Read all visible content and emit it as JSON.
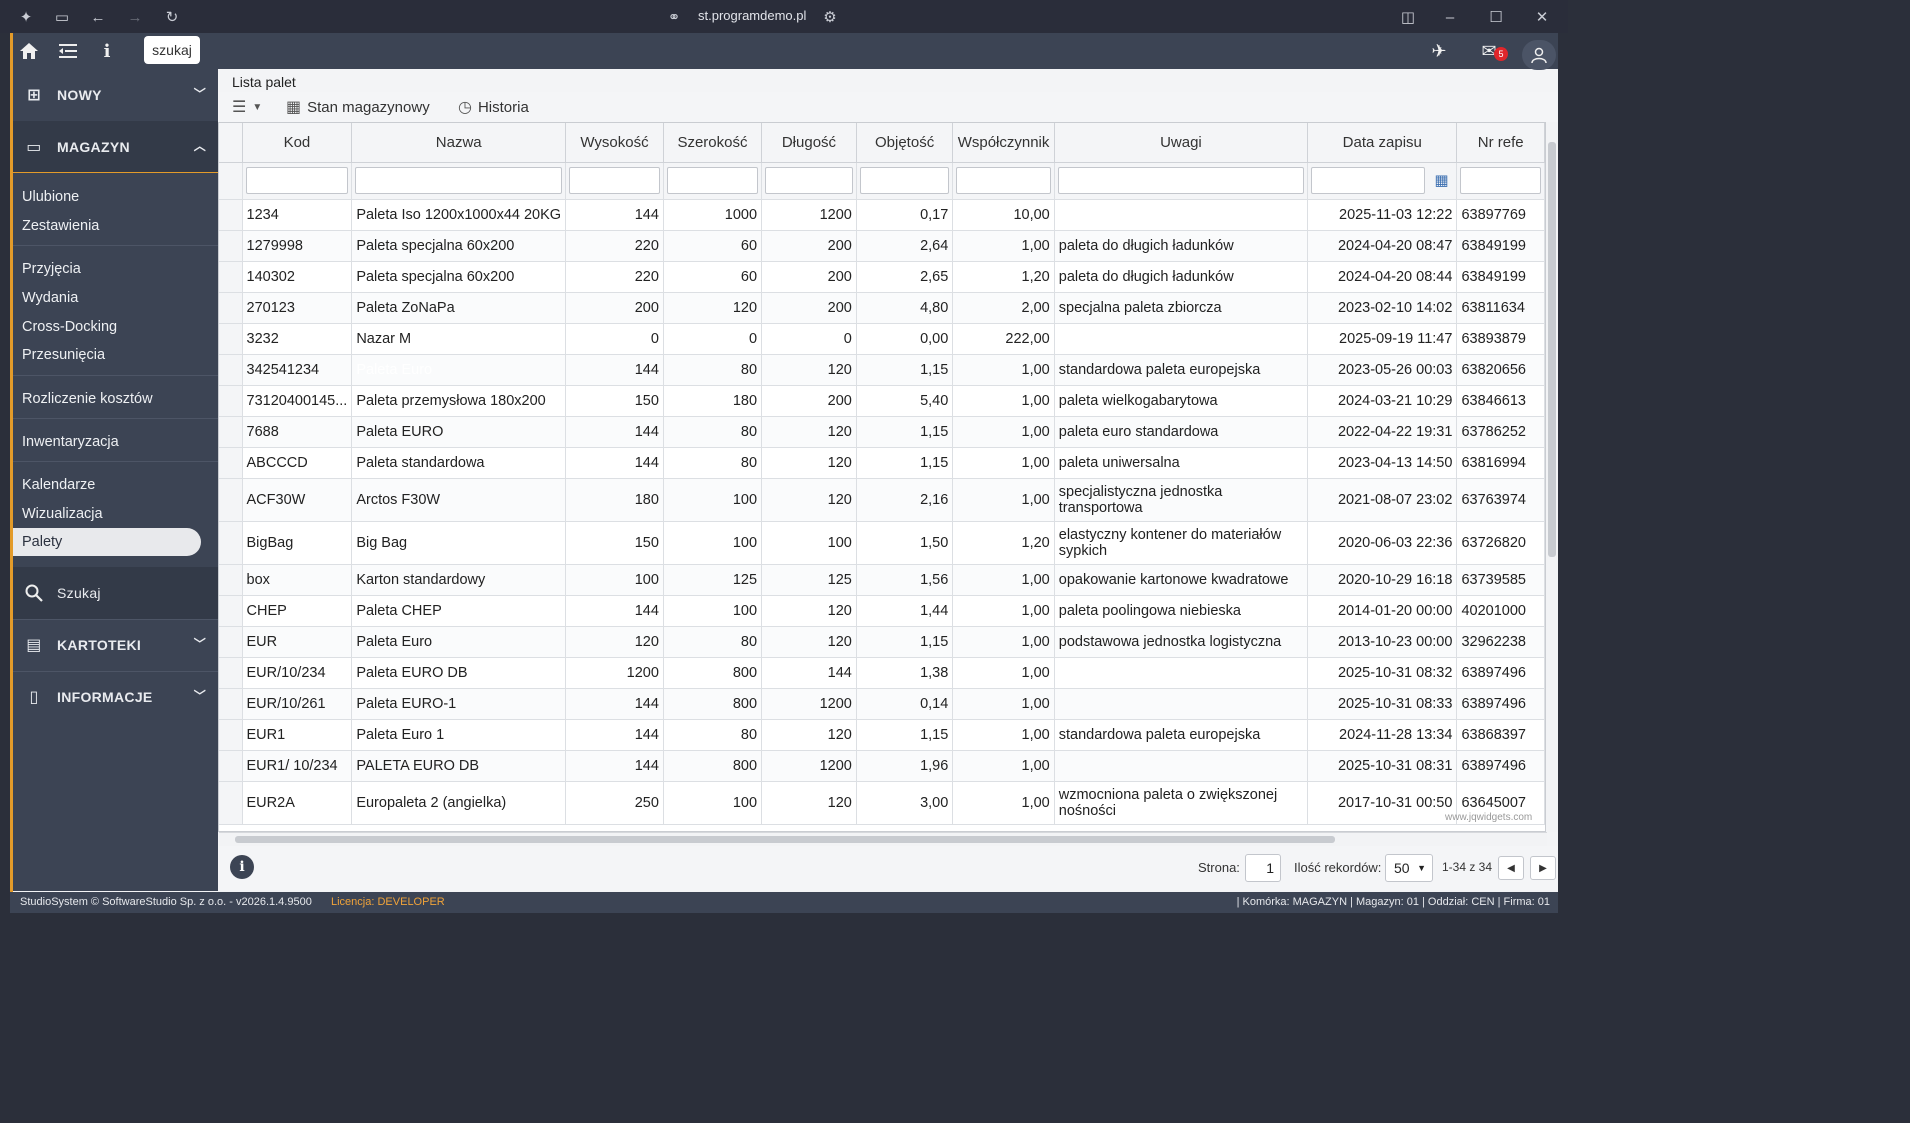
{
  "browser": {
    "url": "st.programdemo.pl"
  },
  "topbar": {
    "search_label": "szukaj",
    "mail_count": "5"
  },
  "sidebar": {
    "sections": {
      "nowy": "NOWY",
      "magazyn": "MAGAZYN",
      "kartoteki": "KARTOTEKI",
      "informacje": "INFORMACJE"
    },
    "items": {
      "ulubione": "Ulubione",
      "zestawienia": "Zestawienia",
      "przyjecia": "Przyjęcia",
      "wydania": "Wydania",
      "cross_docking": "Cross-Docking",
      "przesuniecia": "Przesunięcia",
      "rozliczenie": "Rozliczenie kosztów",
      "inwentaryzacja": "Inwentaryzacja",
      "kalendarze": "Kalendarze",
      "wizualizacja": "Wizualizacja",
      "palety": "Palety",
      "szukaj": "Szukaj"
    }
  },
  "panel": {
    "title": "Lista palet"
  },
  "toolbar": {
    "stan": "Stan magazynowy",
    "historia": "Historia"
  },
  "grid": {
    "columns": [
      "Kod",
      "Nazwa",
      "Wysokość",
      "Szerokość",
      "Długość",
      "Objętość",
      "Współczynnik",
      "Uwagi",
      "Data zapisu",
      "Nr refe"
    ],
    "rows": [
      [
        "1234",
        "Paleta Iso 1200x1000x44 20KG",
        "144",
        "1000",
        "1200",
        "0,17",
        "10,00",
        "",
        "2025-11-03 12:22",
        "63897769"
      ],
      [
        "1279998",
        "Paleta specjalna 60x200",
        "220",
        "60",
        "200",
        "2,64",
        "1,00",
        "paleta do długich ładunków",
        "2024-04-20 08:47",
        "63849199"
      ],
      [
        "140302",
        "Paleta specjalna 60x200",
        "220",
        "60",
        "200",
        "2,65",
        "1,20",
        "paleta do długich ładunków",
        "2024-04-20 08:44",
        "63849199"
      ],
      [
        "270123",
        "Paleta ZoNaPa",
        "200",
        "120",
        "200",
        "4,80",
        "2,00",
        "specjalna paleta zbiorcza",
        "2023-02-10 14:02",
        "63811634"
      ],
      [
        "3232",
        "Nazar M",
        "0",
        "0",
        "0",
        "0,00",
        "222,00",
        "",
        "2025-09-19 11:47",
        "63893879"
      ],
      [
        "342541234",
        "Paleta Euro",
        "144",
        "80",
        "120",
        "1,15",
        "1,00",
        "standardowa paleta europejska",
        "2023-05-26 00:03",
        "63820656"
      ],
      [
        "73120400145...",
        "Paleta przemysłowa 180x200",
        "150",
        "180",
        "200",
        "5,40",
        "1,00",
        "paleta wielkogabarytowa",
        "2024-03-21 10:29",
        "63846613"
      ],
      [
        "7688",
        "Paleta EURO",
        "144",
        "80",
        "120",
        "1,15",
        "1,00",
        "paleta euro standardowa",
        "2022-04-22 19:31",
        "63786252"
      ],
      [
        "ABCCCD",
        "Paleta standardowa",
        "144",
        "80",
        "120",
        "1,15",
        "1,00",
        "paleta uniwersalna",
        "2023-04-13 14:50",
        "63816994"
      ],
      [
        "ACF30W",
        "Arctos F30W",
        "180",
        "100",
        "120",
        "2,16",
        "1,00",
        "specjalistyczna jednostka transportowa",
        "2021-08-07 23:02",
        "63763974"
      ],
      [
        "BigBag",
        "Big Bag",
        "150",
        "100",
        "100",
        "1,50",
        "1,20",
        "elastyczny kontener do materiałów sypkich",
        "2020-06-03 22:36",
        "63726820"
      ],
      [
        "box",
        "Karton standardowy",
        "100",
        "125",
        "125",
        "1,56",
        "1,00",
        "opakowanie kartonowe kwadratowe",
        "2020-10-29 16:18",
        "63739585"
      ],
      [
        "CHEP",
        "Paleta CHEP",
        "144",
        "100",
        "120",
        "1,44",
        "1,00",
        "paleta poolingowa niebieska",
        "2014-01-20 00:00",
        "40201000"
      ],
      [
        "EUR",
        "Paleta Euro",
        "120",
        "80",
        "120",
        "1,15",
        "1,00",
        "podstawowa jednostka logistyczna",
        "2013-10-23 00:00",
        "32962238"
      ],
      [
        "EUR/10/234",
        "Paleta EURO DB",
        "1200",
        "800",
        "144",
        "1,38",
        "1,00",
        "",
        "2025-10-31 08:32",
        "63897496"
      ],
      [
        "EUR/10/261",
        "Paleta EURO-1",
        "144",
        "800",
        "1200",
        "0,14",
        "1,00",
        "",
        "2025-10-31 08:33",
        "63897496"
      ],
      [
        "EUR1",
        "Paleta Euro 1",
        "144",
        "80",
        "120",
        "1,15",
        "1,00",
        "standardowa paleta europejska",
        "2024-11-28 13:34",
        "63868397"
      ],
      [
        "EUR1/ 10/234",
        "PALETA EURO DB",
        "144",
        "800",
        "1200",
        "1,96",
        "1,00",
        "",
        "2025-10-31 08:31",
        "63897496"
      ],
      [
        "EUR2A",
        "Europaleta 2 (angielka)",
        "250",
        "100",
        "120",
        "3,00",
        "1,00",
        "wzmocniona paleta o zwiększonej nośności",
        "2017-10-31 00:50",
        "63645007"
      ]
    ]
  },
  "pager": {
    "strona_label": "Strona:",
    "strona_value": "1",
    "ilosc_label": "Ilość rekordów:",
    "ilosc_value": "50",
    "range": "1-34 z 34"
  },
  "watermark": "www.jqwidgets.com",
  "status": {
    "left": "StudioSystem © SoftwareStudio Sp. z o.o. - v2026.1.4.9500",
    "license_label": "Licencja:",
    "license_value": "DEVELOPER",
    "right": "| Komórka: MAGAZYN | Magazyn: 01 | Oddział: CEN | Firma: 01"
  },
  "colors": {
    "sidebar_bg": "#3c4454",
    "accent": "#e39b2a",
    "selection": "#3a6eb0",
    "badge": "#e0262b"
  }
}
